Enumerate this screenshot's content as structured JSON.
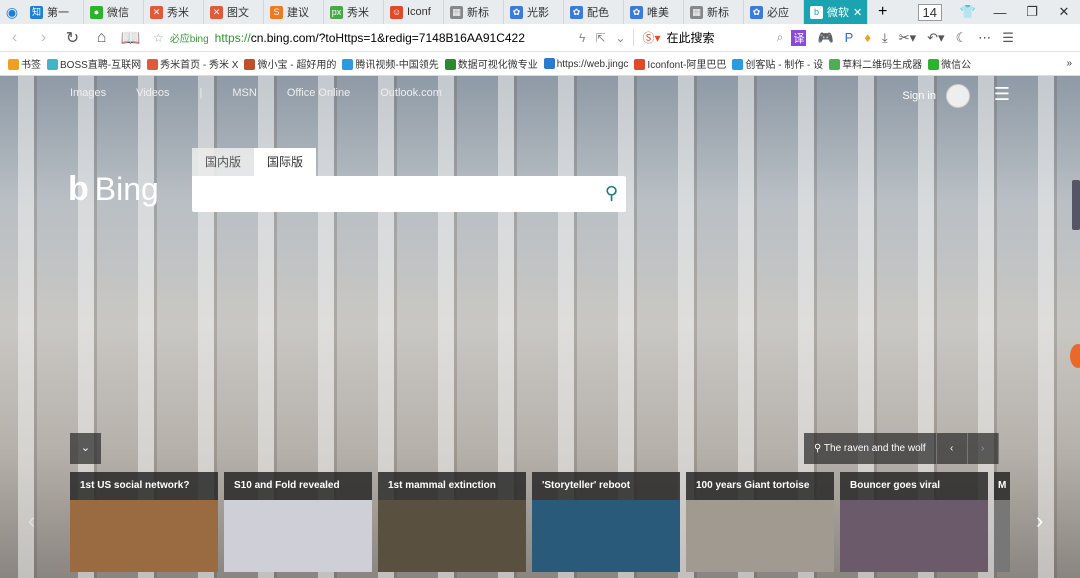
{
  "tabs": [
    {
      "label": "第一",
      "color": "#1e7fd8",
      "icon": "知"
    },
    {
      "label": "微信",
      "color": "#2bb32b",
      "icon": "●"
    },
    {
      "label": "秀米",
      "color": "#e05a3a",
      "icon": "✕"
    },
    {
      "label": "图文",
      "color": "#e05a3a",
      "icon": "✕"
    },
    {
      "label": "建议",
      "color": "#f07a22",
      "icon": "S"
    },
    {
      "label": "秀米",
      "color": "#48a848",
      "icon": "px"
    },
    {
      "label": "Iconf",
      "color": "#e04a2a",
      "icon": "☺"
    },
    {
      "label": "新标",
      "color": "#888",
      "icon": "▦"
    },
    {
      "label": "光影",
      "color": "#3b7be0",
      "icon": "✿"
    },
    {
      "label": "配色",
      "color": "#3b7be0",
      "icon": "✿"
    },
    {
      "label": "唯美",
      "color": "#3b7be0",
      "icon": "✿"
    },
    {
      "label": "新标",
      "color": "#888",
      "icon": "▦"
    },
    {
      "label": "必应",
      "color": "#3b7be0",
      "icon": "✿"
    }
  ],
  "active_tab": {
    "label": "微软",
    "icon": "b"
  },
  "tab_count": "14",
  "address": {
    "site_label": "必应bing",
    "url_scheme": "https://",
    "url_rest": "cn.bing.com/?toHttps=1&redig=7148B16AA91C422",
    "search_placeholder": "在此搜索"
  },
  "bookmarks": [
    {
      "label": "书签",
      "color": "#f0a020"
    },
    {
      "label": "BOSS直聘-互联网",
      "color": "#3fb5c8"
    },
    {
      "label": "秀米首页 - 秀米 X",
      "color": "#e05a3a"
    },
    {
      "label": "微小宝 - 超好用的",
      "color": "#c0502a"
    },
    {
      "label": "腾讯视频-中国领先",
      "color": "#2b9ae0"
    },
    {
      "label": "数据可视化微专业",
      "color": "#2b8a2b"
    },
    {
      "label": "https://web.jingc",
      "color": "#2b7ad0"
    },
    {
      "label": "Iconfont-阿里巴巴",
      "color": "#e04a2a"
    },
    {
      "label": "创客贴 - 制作 - 设",
      "color": "#2b9ae0"
    },
    {
      "label": "草料二维码生成器",
      "color": "#4caf50"
    },
    {
      "label": "微信公",
      "color": "#2bb32b"
    }
  ],
  "bing": {
    "nav": [
      "Images",
      "Videos",
      "|",
      "MSN",
      "Office Online",
      "Outlook.com"
    ],
    "sign_in": "Sign in",
    "logo": "Bing",
    "search_tabs": [
      "国内版",
      "国际版"
    ],
    "caption": "The raven and the wolf",
    "cards": [
      {
        "title": "1st US social network?",
        "color": "#9a6a40"
      },
      {
        "title": "S10 and Fold revealed",
        "color": "#cfcfd8"
      },
      {
        "title": "1st mammal extinction",
        "color": "#5a5040"
      },
      {
        "title": "'Storyteller' reboot",
        "color": "#2a5a7a"
      },
      {
        "title": "100 years Giant tortoise",
        "color": "#a09a90"
      },
      {
        "title": "Bouncer goes viral",
        "color": "#6a5a6a"
      }
    ],
    "partial_card": "M"
  }
}
